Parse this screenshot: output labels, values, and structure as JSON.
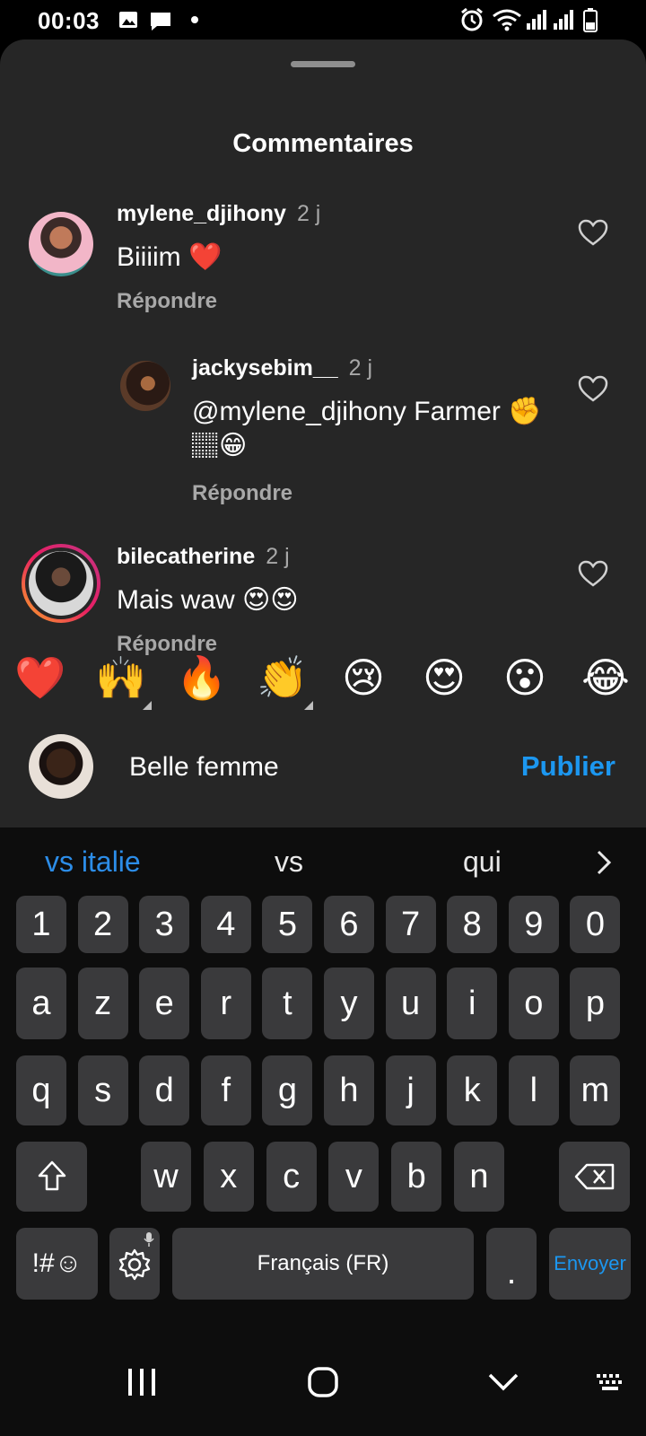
{
  "status_bar": {
    "time": "00:03",
    "icons_left": [
      "gallery-icon",
      "message-icon",
      "dot-icon"
    ],
    "icons_right": [
      "alarm-icon",
      "wifi-icon",
      "signal-icon",
      "signal-icon",
      "battery-icon"
    ]
  },
  "sheet": {
    "title": "Commentaires"
  },
  "comments": [
    {
      "username": "mylene_djihony",
      "time": "2 j",
      "text": "Biiiim ❤️",
      "reply_label": "Répondre"
    },
    {
      "username": "jackysebim__",
      "time": "2 j",
      "text_line1": "@mylene_djihony Farmer ✊",
      "text_line2": "🏽😁",
      "reply_label": "Répondre"
    },
    {
      "username": "bilecatherine",
      "time": "2 j",
      "text": "Mais waw 😍😍",
      "reply_label": "Répondre"
    }
  ],
  "emoji_bar": [
    "❤️",
    "🙌",
    "🔥",
    "👏",
    "😢",
    "😍",
    "😮",
    "😂"
  ],
  "input": {
    "value": "Belle femme",
    "publish_label": "Publier"
  },
  "keyboard": {
    "suggestions": [
      "vs italie",
      "vs",
      "qui"
    ],
    "row_numbers": [
      "1",
      "2",
      "3",
      "4",
      "5",
      "6",
      "7",
      "8",
      "9",
      "0"
    ],
    "row1": [
      "a",
      "z",
      "e",
      "r",
      "t",
      "y",
      "u",
      "i",
      "o",
      "p"
    ],
    "row2": [
      "q",
      "s",
      "d",
      "f",
      "g",
      "h",
      "j",
      "k",
      "l",
      "m"
    ],
    "row3": [
      "w",
      "x",
      "c",
      "v",
      "b",
      "n"
    ],
    "symbols_label": "!#☺",
    "space_label": "Français (FR)",
    "period_label": ".",
    "send_label": "Envoyer"
  },
  "colors": {
    "sheet_bg": "#262626",
    "accent_blue": "#1c97f0",
    "keyboard_bg": "#0d0d0d",
    "key_bg": "#3a3a3c",
    "muted_text": "#a8a8a8",
    "heart_red": "#e8292c"
  }
}
